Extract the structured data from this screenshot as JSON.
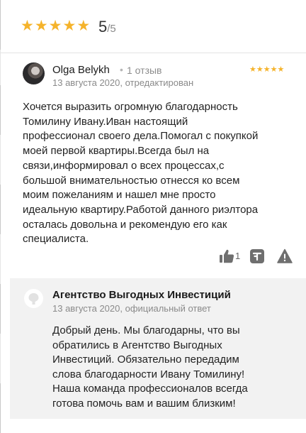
{
  "rating": {
    "stars": [
      "★",
      "★",
      "★",
      "★",
      "★"
    ],
    "value": "5",
    "out_of": "/5"
  },
  "review": {
    "author": "Olga Belykh",
    "separator": "•",
    "review_count": "1 отзыв",
    "stars": [
      "★",
      "★",
      "★",
      "★",
      "★"
    ],
    "date": "13 августа 2020, отредактирован",
    "lines": [
      "Хочется выразить огромную благодарность",
      "Томилину Ивану.Иван настоящий",
      "профессионал своего дела.Помогал с покупкой",
      "моей первой квартиры.Всегда был на",
      "связи,информировал о всех процессах,с",
      "большой внимательностью отнесся ко всем",
      "моим пожеланиям и нашел мне просто",
      "идеальную квартиру.Работой данного риэлтора",
      "осталась довольна и рекомендую его как",
      "специалиста."
    ],
    "likes": "1"
  },
  "reply": {
    "author": "Агентство Выгодных Инвестиций",
    "date": "13 августа 2020, официальный ответ",
    "lines": [
      "Добрый день. Мы благодарны, что вы",
      "обратились в Агентство Выгодных",
      "Инвестиций. Обязательно передадим",
      "слова благодарности Ивану Томилину!",
      "Наша команда профессионалов всегда",
      "готова помочь вам и вашим близким!"
    ]
  },
  "colors": {
    "star": "#f5b32b",
    "icon": "#6f6f6f",
    "reply_bg": "#f2f2f2"
  },
  "icons": {
    "like": "thumbs-up-icon",
    "share": "share-icon",
    "report": "warning-icon"
  }
}
